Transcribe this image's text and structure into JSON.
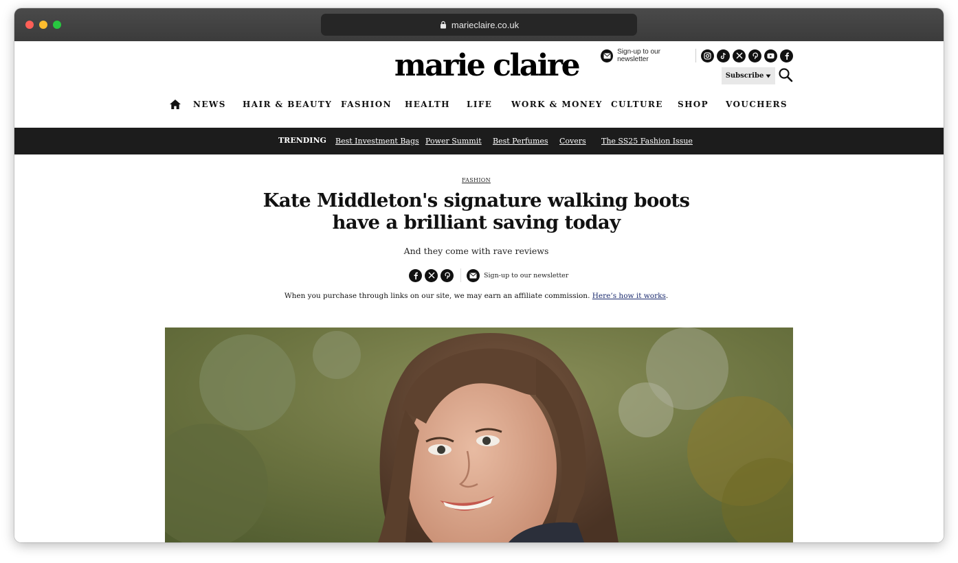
{
  "browser": {
    "url": "marieclaire.co.uk"
  },
  "header": {
    "logo": "marie claire",
    "newsletter": "Sign-up to our newsletter",
    "social_icons": [
      "instagram-icon",
      "tiktok-icon",
      "x-icon",
      "pinterest-icon",
      "youtube-icon",
      "facebook-icon"
    ],
    "subscribe_label": "Subscribe"
  },
  "nav": {
    "items": [
      "NEWS",
      "HAIR & BEAUTY",
      "FASHION",
      "HEALTH",
      "LIFE",
      "WORK & MONEY",
      "CULTURE",
      "SHOP",
      "VOUCHERS"
    ]
  },
  "trending": {
    "label": "TRENDING",
    "links": [
      "Best Investment Bags",
      "Power Summit",
      "Best Perfumes",
      "Covers",
      "The SS25 Fashion Issue"
    ]
  },
  "article": {
    "category": "FASHION",
    "headline": "Kate Middleton's signature walking boots have a brilliant saving today",
    "standfirst": "And they come with rave reviews",
    "share_newsletter": "Sign-up to our newsletter",
    "affiliate_text": "When you purchase through links on our site, we may earn an affiliate commission.",
    "affiliate_link": "Here’s how it works",
    "affiliate_end": "."
  },
  "colors": {
    "trending_bar": "#1c1c1c",
    "text": "#111111",
    "link": "#1a2a6e"
  }
}
